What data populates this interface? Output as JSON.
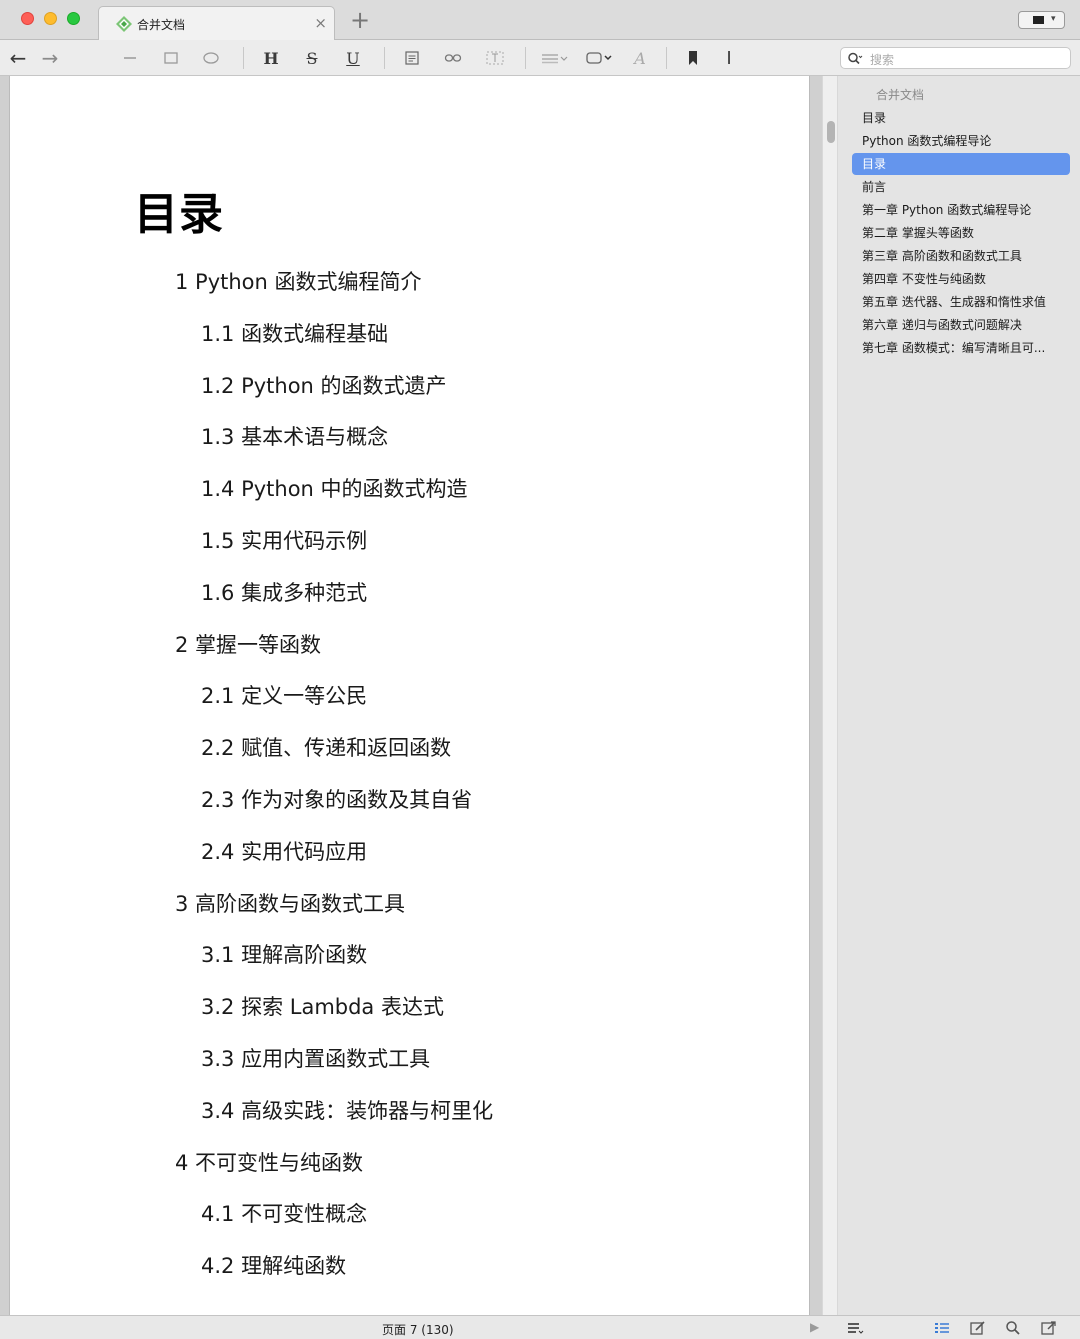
{
  "tab": {
    "title": "合并文档",
    "close_glyph": "×",
    "add_glyph": "+"
  },
  "toolbar": {
    "back_glyph": "←",
    "forward_glyph": "→",
    "heading_label": "H",
    "strike_label": "S",
    "underline_label": "U",
    "font_label": "A",
    "cursor_label": "I",
    "search_placeholder": "搜索"
  },
  "document": {
    "title": "目录",
    "toc": [
      {
        "text": "1 Python 函数式编程简介",
        "level": 1
      },
      {
        "text": "1.1 函数式编程基础",
        "level": 2
      },
      {
        "text": "1.2 Python 的函数式遗产",
        "level": 2
      },
      {
        "text": "1.3 基本术语与概念",
        "level": 2
      },
      {
        "text": "1.4 Python 中的函数式构造",
        "level": 2
      },
      {
        "text": "1.5 实用代码示例",
        "level": 2
      },
      {
        "text": "1.6 集成多种范式",
        "level": 2
      },
      {
        "text": "2 掌握一等函数",
        "level": 1
      },
      {
        "text": "2.1 定义一等公民",
        "level": 2
      },
      {
        "text": "2.2 赋值、传递和返回函数",
        "level": 2
      },
      {
        "text": "2.3 作为对象的函数及其自省",
        "level": 2
      },
      {
        "text": "2.4 实用代码应用",
        "level": 2
      },
      {
        "text": "3 高阶函数与函数式工具",
        "level": 1
      },
      {
        "text": "3.1 理解高阶函数",
        "level": 2
      },
      {
        "text": "3.2 探索 Lambda 表达式",
        "level": 2
      },
      {
        "text": "3.3 应用内置函数式工具",
        "level": 2
      },
      {
        "text": "3.4 高级实践：装饰器与柯里化",
        "level": 2
      },
      {
        "text": "4 不可变性与纯函数",
        "level": 1
      },
      {
        "text": "4.1 不可变性概念",
        "level": 2
      },
      {
        "text": "4.2 理解纯函数",
        "level": 2
      }
    ]
  },
  "sidebar": {
    "items": [
      {
        "label": "合并文档",
        "kind": "header"
      },
      {
        "label": "目录"
      },
      {
        "label": "Python 函数式编程导论"
      },
      {
        "label": "目录",
        "selected": true
      },
      {
        "label": "前言"
      },
      {
        "label": "第一章 Python 函数式编程导论"
      },
      {
        "label": "第二章 掌握头等函数"
      },
      {
        "label": "第三章 高阶函数和函数式工具"
      },
      {
        "label": "第四章 不变性与纯函数"
      },
      {
        "label": "第五章 迭代器、生成器和惰性求值"
      },
      {
        "label": "第六章 递归与函数式问题解决"
      },
      {
        "label": "第七章 函数模式：编写清晰且可..."
      }
    ]
  },
  "status": {
    "page_text": "页面 7 (130)",
    "play_glyph": "▶"
  },
  "colors": {
    "selection": "#6495ed",
    "accent_green": "#5cb85c"
  }
}
